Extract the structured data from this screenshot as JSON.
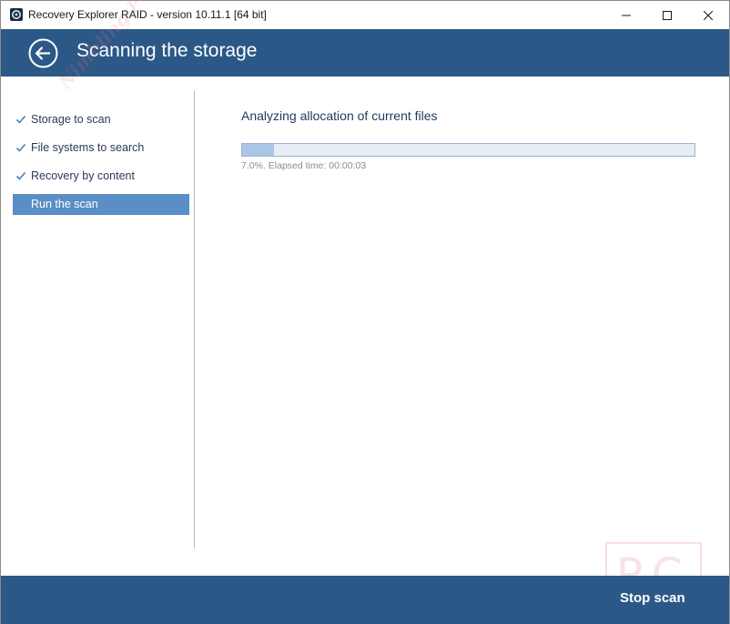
{
  "window": {
    "title": "Recovery Explorer RAID - version 10.11.1 [64 bit]"
  },
  "header": {
    "title": "Scanning the storage"
  },
  "sidebar": {
    "steps": [
      {
        "label": "Storage to scan",
        "done": true
      },
      {
        "label": "File systems to search",
        "done": true
      },
      {
        "label": "Recovery by content",
        "done": true
      },
      {
        "label": "Run the scan",
        "done": false,
        "active": true
      }
    ]
  },
  "main": {
    "heading": "Analyzing allocation of current files",
    "progress_fraction": 0.07,
    "progress_text": "7.0%. Elapsed time: 00:00:03"
  },
  "footer": {
    "stop_label": "Stop scan"
  },
  "watermark": {
    "side_text": "Nimbling PC",
    "box_text": "PC"
  },
  "colors": {
    "header_bg": "#2c5887",
    "active_step": "#5b8ec7",
    "progress_fill": "#a9c6e6"
  }
}
